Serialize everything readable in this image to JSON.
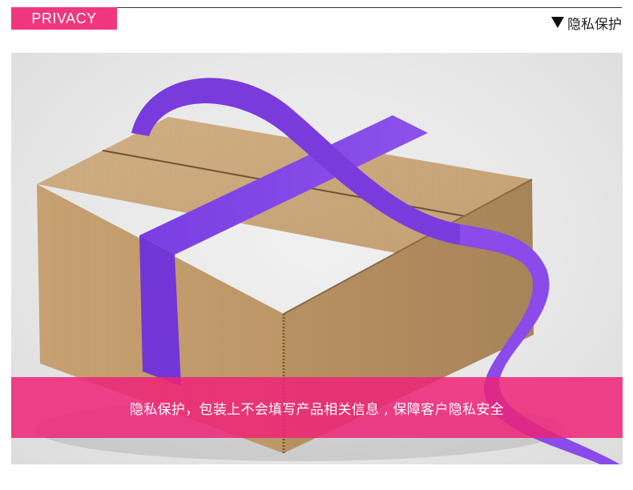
{
  "header": {
    "tag_label": "PRIVACY",
    "right_title": "隐私保护"
  },
  "photo": {
    "subject": "kraft-box-with-purple-ribbon"
  },
  "banner": {
    "text": "隐私保护，包装上不会填写产品相关信息 , 保障客户隐私安全"
  },
  "colors": {
    "accent": "#f0377d",
    "banner": "#ee2478",
    "ribbon": "#7b3fe0",
    "kraft": "#c9a579"
  }
}
